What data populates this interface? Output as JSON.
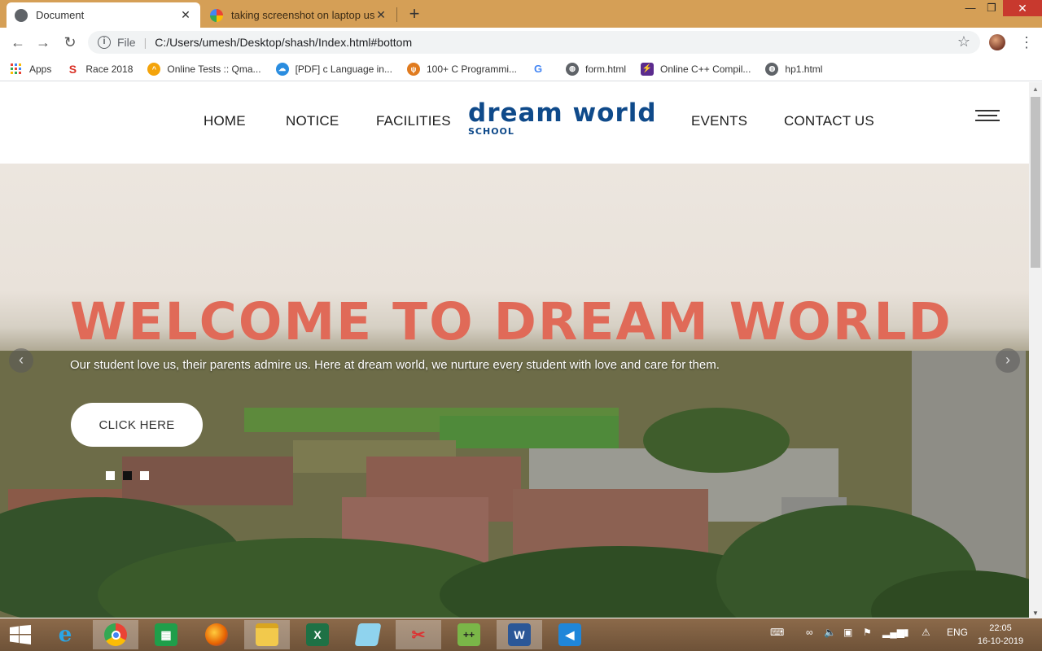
{
  "browser": {
    "tabs": [
      {
        "title": "Document",
        "active": true
      },
      {
        "title": "taking screenshot on laptop usin",
        "active": false
      }
    ],
    "new_tab_symbol": "+",
    "window_controls": {
      "minimize": "—",
      "maximize": "❐",
      "close": "✕"
    },
    "nav": {
      "back": "←",
      "forward": "→",
      "reload": "↻"
    },
    "address": {
      "scheme_label": "File",
      "url": "C:/Users/umesh/Desktop/shash/Index.html#bottom"
    },
    "bookmarks": [
      {
        "label": "Apps",
        "icon": "apps-grid-icon"
      },
      {
        "label": "Race 2018",
        "icon": "race-s-icon"
      },
      {
        "label": "Online Tests :: Qma...",
        "icon": "qmarks-icon"
      },
      {
        "label": "[PDF] c Language in...",
        "icon": "pdf-icon"
      },
      {
        "label": "100+ C Programmi...",
        "icon": "c-programs-icon"
      },
      {
        "label": "",
        "icon": "google-icon"
      },
      {
        "label": "form.html",
        "icon": "globe-icon"
      },
      {
        "label": "Online C++ Compil...",
        "icon": "compiler-icon"
      },
      {
        "label": "hp1.html",
        "icon": "globe-icon"
      }
    ]
  },
  "site": {
    "nav_left": [
      "HOME",
      "NOTICE",
      "FACILITIES"
    ],
    "nav_right": [
      "EVENTS",
      "CONTACT US"
    ],
    "logo_text": "dream world",
    "logo_sub": "SCHOOL",
    "hero": {
      "title": "WELCOME TO DREAM WORLD",
      "subtitle": "Our student love us, their parents admire us. Here at dream world, we nurture every student with love and care for them.",
      "button": "CLICK HERE",
      "slides": 3,
      "active_slide": 2,
      "prev": "‹",
      "next": "›"
    },
    "colors": {
      "title": "#e06a58",
      "logo": "#0f4a8a"
    }
  },
  "taskbar": {
    "apps": [
      "internet-explorer-icon",
      "chrome-icon",
      "store-icon",
      "firefox-icon",
      "file-explorer-icon",
      "excel-icon",
      "notepad-icon",
      "snipping-tool-icon",
      "code-editor-icon",
      "word-icon",
      "vscode-icon"
    ],
    "active_app": "chrome-icon",
    "language": "ENG",
    "time": "22:05",
    "date": "16-10-2019"
  }
}
